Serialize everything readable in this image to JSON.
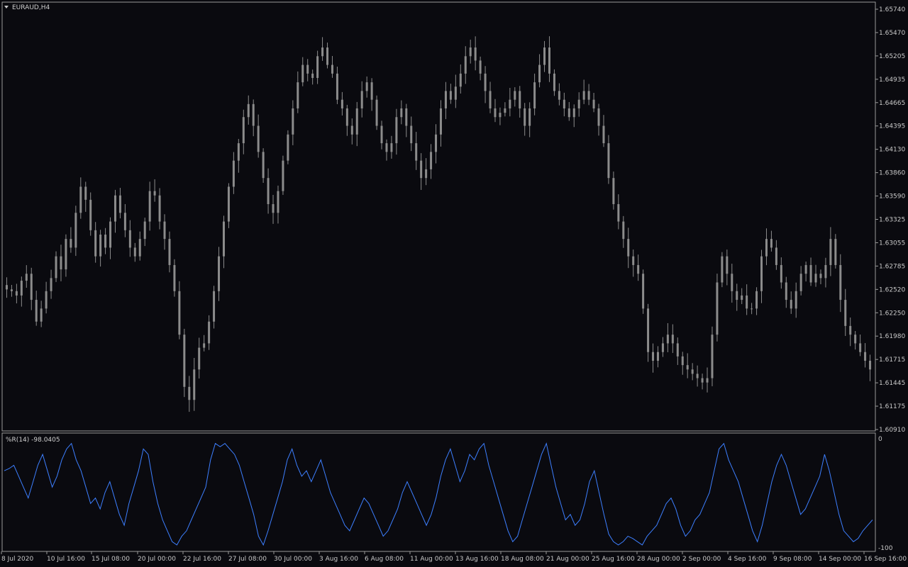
{
  "window": {
    "symbol_label": "EURAUD,H4",
    "menu_icon": "triangle-down-icon"
  },
  "indicator": {
    "label": "%R(14) -98.0405",
    "scale_top": "0",
    "scale_bottom": "-100"
  },
  "colors": {
    "background": "#0a0a0f",
    "candle": "#8c8c8c",
    "indicator_line": "#3d7fff",
    "axis_text": "#c8c8c8",
    "border": "#9a9a9a"
  },
  "price_axis": [
    "1.65740",
    "1.65470",
    "1.65205",
    "1.64935",
    "1.64665",
    "1.64395",
    "1.64130",
    "1.63860",
    "1.63590",
    "1.63325",
    "1.63055",
    "1.62785",
    "1.62520",
    "1.62250",
    "1.61980",
    "1.61715",
    "1.61445",
    "1.61175",
    "1.60910"
  ],
  "time_axis": [
    "8 Jul 2020",
    "10 Jul 16:00",
    "15 Jul 08:00",
    "20 Jul 00:00",
    "22 Jul 16:00",
    "27 Jul 08:00",
    "30 Jul 00:00",
    "3 Aug 16:00",
    "6 Aug 08:00",
    "11 Aug 00:00",
    "13 Aug 16:00",
    "18 Aug 08:00",
    "21 Aug 00:00",
    "25 Aug 16:00",
    "28 Aug 00:00",
    "2 Sep 00:00",
    "4 Sep 16:00",
    "9 Sep 08:00",
    "14 Sep 00:00",
    "16 Sep 16:00"
  ],
  "chart_data": [
    {
      "type": "candlestick",
      "title": "EURAUD,H4",
      "ylim": [
        1.6091,
        1.6574
      ],
      "close_path": [
        1.6252,
        1.625,
        1.6245,
        1.6262,
        1.627,
        1.624,
        1.6215,
        1.623,
        1.625,
        1.6265,
        1.629,
        1.6275,
        1.631,
        1.63,
        1.634,
        1.637,
        1.6355,
        1.632,
        1.629,
        1.6315,
        1.63,
        1.633,
        1.636,
        1.634,
        1.632,
        1.63,
        1.629,
        1.631,
        1.633,
        1.6365,
        1.636,
        1.633,
        1.631,
        1.628,
        1.625,
        1.62,
        1.614,
        1.6125,
        1.616,
        1.6185,
        1.619,
        1.6215,
        1.625,
        1.629,
        1.633,
        1.637,
        1.64,
        1.642,
        1.645,
        1.6465,
        1.644,
        1.641,
        1.638,
        1.635,
        1.634,
        1.6365,
        1.64,
        1.643,
        1.646,
        1.649,
        1.651,
        1.65,
        1.6495,
        1.652,
        1.653,
        1.651,
        1.65,
        1.647,
        1.646,
        1.644,
        1.643,
        1.646,
        1.648,
        1.649,
        1.647,
        1.644,
        1.642,
        1.641,
        1.642,
        1.645,
        1.646,
        1.644,
        1.642,
        1.64,
        1.638,
        1.639,
        1.641,
        1.643,
        1.646,
        1.648,
        1.647,
        1.6485,
        1.65,
        1.652,
        1.653,
        1.6515,
        1.65,
        1.648,
        1.646,
        1.645,
        1.6455,
        1.646,
        1.647,
        1.648,
        1.646,
        1.644,
        1.646,
        1.649,
        1.651,
        1.653,
        1.65,
        1.648,
        1.647,
        1.646,
        1.645,
        1.646,
        1.647,
        1.648,
        1.647,
        1.646,
        1.644,
        1.642,
        1.638,
        1.635,
        1.633,
        1.631,
        1.629,
        1.628,
        1.627,
        1.623,
        1.618,
        1.617,
        1.618,
        1.619,
        1.62,
        1.619,
        1.6175,
        1.6165,
        1.616,
        1.6155,
        1.615,
        1.6145,
        1.615,
        1.62,
        1.626,
        1.629,
        1.627,
        1.625,
        1.624,
        1.6245,
        1.623,
        1.623,
        1.625,
        1.629,
        1.631,
        1.63,
        1.628,
        1.626,
        1.624,
        1.623,
        1.625,
        1.627,
        1.628,
        1.626,
        1.627,
        1.6265,
        1.628,
        1.631,
        1.628,
        1.624,
        1.621,
        1.62,
        1.619,
        1.618,
        1.617,
        1.616
      ]
    },
    {
      "type": "line",
      "title": "%R(14) -98.0405",
      "ylim": [
        -100,
        0
      ],
      "values": [
        -30,
        -28,
        -25,
        -35,
        -45,
        -55,
        -40,
        -25,
        -15,
        -30,
        -45,
        -35,
        -20,
        -10,
        -5,
        -20,
        -30,
        -45,
        -60,
        -55,
        -65,
        -50,
        -40,
        -55,
        -70,
        -80,
        -60,
        -45,
        -30,
        -10,
        -15,
        -40,
        -60,
        -75,
        -85,
        -95,
        -98,
        -90,
        -85,
        -75,
        -65,
        -55,
        -45,
        -20,
        -5,
        -8,
        -5,
        -10,
        -15,
        -25,
        -40,
        -55,
        -70,
        -90,
        -98,
        -85,
        -70,
        -55,
        -40,
        -20,
        -10,
        -25,
        -35,
        -30,
        -40,
        -30,
        -20,
        -35,
        -50,
        -60,
        -70,
        -80,
        -85,
        -75,
        -65,
        -55,
        -60,
        -70,
        -80,
        -90,
        -85,
        -75,
        -65,
        -50,
        -40,
        -50,
        -60,
        -70,
        -80,
        -70,
        -55,
        -35,
        -20,
        -10,
        -25,
        -40,
        -30,
        -15,
        -20,
        -10,
        -5,
        -25,
        -40,
        -55,
        -70,
        -85,
        -95,
        -90,
        -75,
        -60,
        -45,
        -30,
        -15,
        -5,
        -25,
        -45,
        -60,
        -75,
        -70,
        -80,
        -75,
        -60,
        -40,
        -30,
        -50,
        -70,
        -88,
        -95,
        -98,
        -95,
        -90,
        -92,
        -95,
        -98,
        -90,
        -85,
        -80,
        -70,
        -60,
        -55,
        -65,
        -80,
        -90,
        -85,
        -75,
        -70,
        -60,
        -50,
        -30,
        -10,
        -5,
        -20,
        -30,
        -40,
        -55,
        -70,
        -85,
        -95,
        -80,
        -60,
        -40,
        -25,
        -15,
        -25,
        -40,
        -55,
        -70,
        -65,
        -55,
        -45,
        -35,
        -15,
        -30,
        -50,
        -70,
        -85,
        -90,
        -95,
        -92,
        -85,
        -80,
        -75
      ]
    }
  ]
}
